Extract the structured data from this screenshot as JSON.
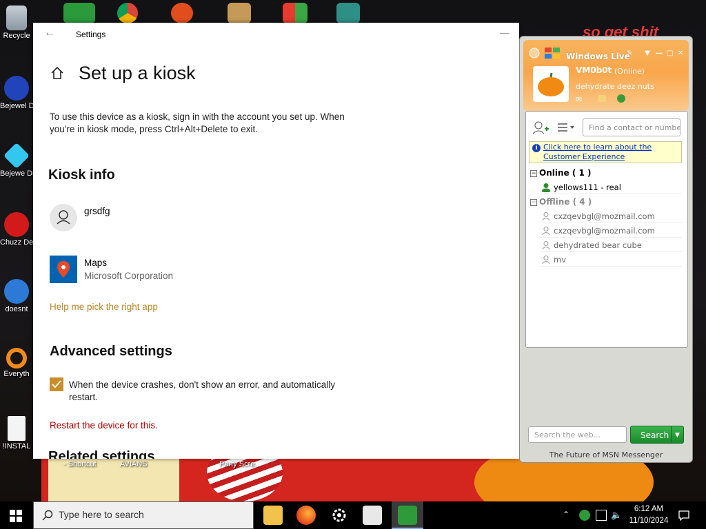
{
  "desktop": {
    "icons": [
      {
        "label": "Recycle"
      },
      {
        "label": "Bejewel Delux"
      },
      {
        "label": "Bejewe Delux"
      },
      {
        "label": "Chuzz Delux"
      },
      {
        "label": "doesnt"
      },
      {
        "label": "Everyth"
      },
      {
        "label": "!INSTAL"
      }
    ],
    "wall_labels": {
      "shortcut": "- Shortcut",
      "avians": "AVIANS",
      "party": "Party Scre..."
    },
    "wall_text": "so get shit"
  },
  "settings": {
    "window_title": "Settings",
    "page_title": "Set up a kiosk",
    "description": "To use this device as a kiosk, sign in with the account you set up. When you're in kiosk mode, press Ctrl+Alt+Delete to exit.",
    "kiosk_info_heading": "Kiosk info",
    "account_name": "grsdfg",
    "app_name": "Maps",
    "app_publisher": "Microsoft Corporation",
    "help_link": "Help me pick the right app",
    "advanced_heading": "Advanced settings",
    "crash_checkbox_label": "When the device crashes, don't show an error, and automatically restart.",
    "crash_checkbox_checked": true,
    "restart_link": "Restart the device for this.",
    "related_heading": "Related settings"
  },
  "msn": {
    "brand": "Windows Live",
    "username": "VM0b0t",
    "status": "(Online)",
    "personal_message": "dehydrate deez nuts",
    "contact_search_placeholder": "Find a contact or number",
    "notice_text": "Click here to learn about the Customer Experience",
    "groups": [
      {
        "label": "Online ( 1 )",
        "contacts": [
          {
            "name": "yellows111 - real",
            "status": "online"
          }
        ]
      },
      {
        "label": "Offline ( 4 )",
        "contacts": [
          {
            "name": "cxzqevbgl@mozmail.com",
            "status": "offline"
          },
          {
            "name": "cxzqevbgl@mozmail.com",
            "status": "offline"
          },
          {
            "name": "dehydrated bear cube",
            "status": "offline"
          },
          {
            "name": "mv",
            "status": "offline"
          }
        ]
      }
    ],
    "web_search_placeholder": "Search the web...",
    "search_button": "Search",
    "footer": "The Future of MSN Messenger",
    "colors": {
      "header": "#f9a64c",
      "online": "#2e8b2e",
      "offline": "#999999",
      "search_button": "#1b8a2a"
    }
  },
  "taskbar": {
    "search_placeholder": "Type here to search",
    "time": "6:12 AM",
    "date": "11/10/2024",
    "apps": [
      "file-explorer-icon",
      "firefox-icon",
      "settings-gear-icon",
      "notepad-icon",
      "msn-messenger-icon"
    ]
  }
}
